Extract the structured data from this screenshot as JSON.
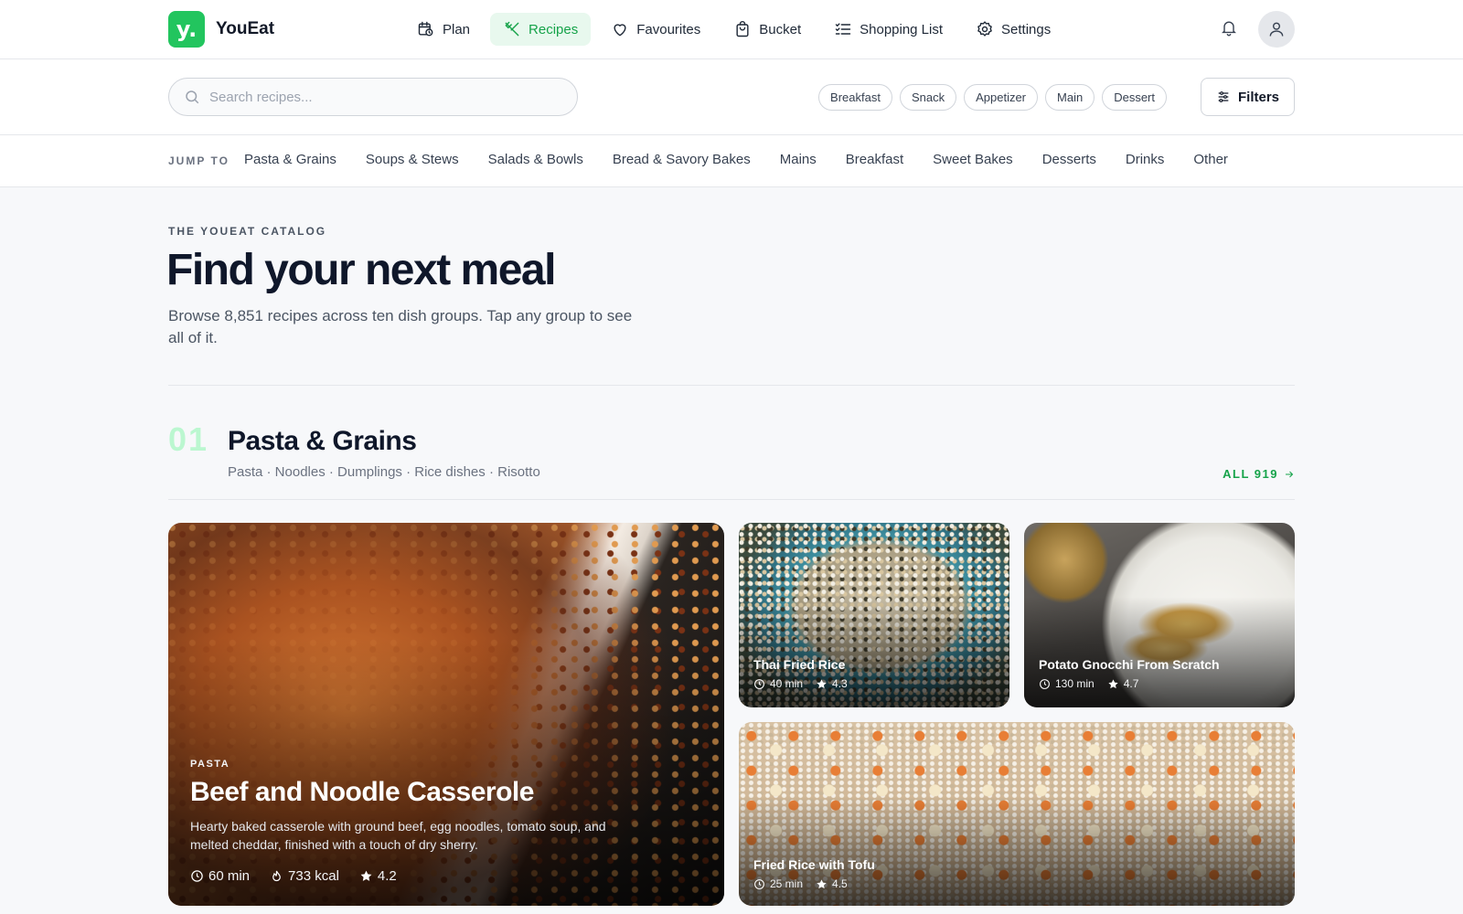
{
  "app": {
    "name": "YouEat",
    "logo_glyph": "y.",
    "accent": "#22c55e"
  },
  "nav": {
    "items": [
      {
        "label": "Plan",
        "icon": "calendar-clock-icon"
      },
      {
        "label": "Recipes",
        "icon": "utensils-icon",
        "active": true
      },
      {
        "label": "Favourites",
        "icon": "heart-icon"
      },
      {
        "label": "Bucket",
        "icon": "shopping-bag-icon"
      },
      {
        "label": "Shopping List",
        "icon": "checklist-icon"
      },
      {
        "label": "Settings",
        "icon": "gear-icon"
      }
    ]
  },
  "search": {
    "placeholder": "Search recipes...",
    "value": ""
  },
  "chips": [
    "Breakfast",
    "Snack",
    "Appetizer",
    "Main",
    "Dessert"
  ],
  "filters_label": "Filters",
  "jump": {
    "label": "JUMP TO",
    "links": [
      "Pasta & Grains",
      "Soups & Stews",
      "Salads & Bowls",
      "Bread & Savory Bakes",
      "Mains",
      "Breakfast",
      "Sweet Bakes",
      "Desserts",
      "Drinks",
      "Other"
    ]
  },
  "hero": {
    "eyebrow": "THE YOUEAT CATALOG",
    "title": "Find your next meal",
    "subtitle": "Browse 8,851 recipes across ten dish groups. Tap any group to see all of it."
  },
  "section": {
    "number": "01",
    "title": "Pasta & Grains",
    "subtitle": "Pasta · Noodles · Dumplings · Rice dishes · Risotto",
    "all_label": "ALL 919"
  },
  "featured": {
    "category": "PASTA",
    "title": "Beef and Noodle Casserole",
    "description": "Hearty baked casserole with ground beef, egg noodles, tomato soup, and melted cheddar, finished with a touch of dry sherry.",
    "time": "60 min",
    "kcal": "733 kcal",
    "rating": "4.2"
  },
  "cards": [
    {
      "title": "Thai Fried Rice",
      "time": "40 min",
      "rating": "4.3"
    },
    {
      "title": "Potato Gnocchi From Scratch",
      "time": "130 min",
      "rating": "4.7"
    },
    {
      "title": "Fried Rice with Tofu",
      "time": "25 min",
      "rating": "4.5"
    }
  ]
}
